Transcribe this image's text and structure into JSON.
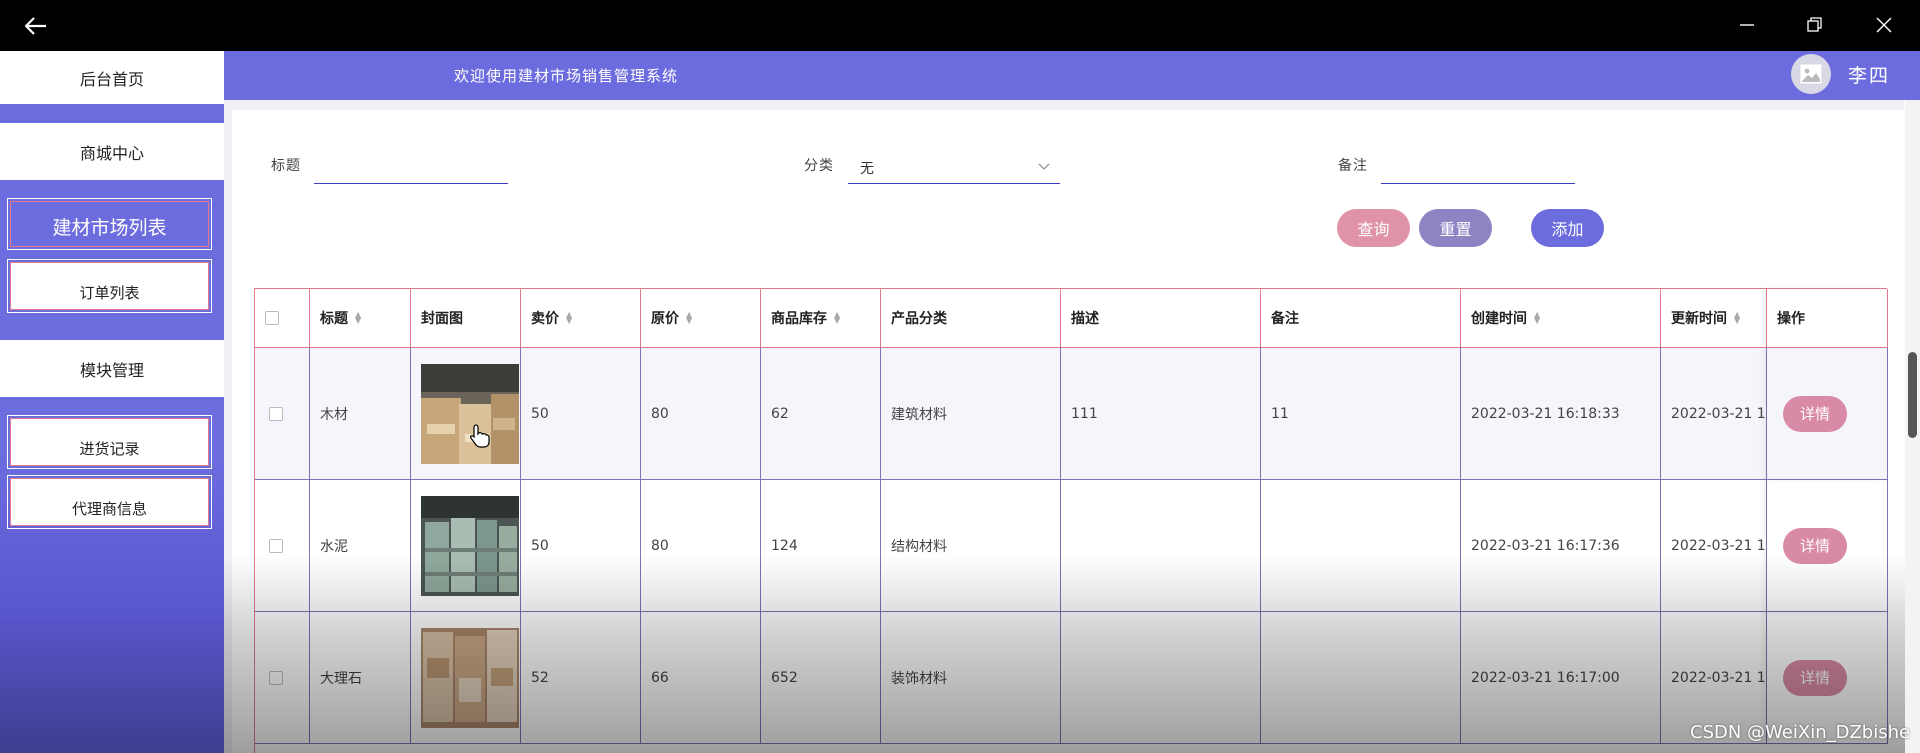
{
  "titlebar": {
    "back_icon": "arrow-left-icon",
    "minimize_icon": "minimize-icon",
    "restore_icon": "restore-icon",
    "close_icon": "close-icon"
  },
  "header": {
    "welcome": "欢迎使用建材市场销售管理系统",
    "username": "李四",
    "avatar_icon": "image-icon"
  },
  "sidebar": {
    "home": "后台首页",
    "mall_center": "商城中心",
    "market_list": "建材市场列表",
    "order_list": "订单列表",
    "module_mgmt": "模块管理",
    "purchase_records": "进货记录",
    "agent_info": "代理商信息"
  },
  "search": {
    "title_label": "标题",
    "title_value": "",
    "category_label": "分类",
    "category_value": "无",
    "remark_label": "备注",
    "remark_value": "",
    "query_btn": "查询",
    "reset_btn": "重置",
    "add_btn": "添加",
    "colors": {
      "query": "#df92a8",
      "reset": "#8e84c4",
      "add": "#6c6cdf"
    }
  },
  "table": {
    "headers": [
      "标题",
      "封面图",
      "卖价",
      "原价",
      "商品库存",
      "产品分类",
      "描述",
      "备注",
      "创建时间",
      "更新时间",
      "操作"
    ],
    "rows": [
      {
        "title": "木材",
        "price": "50",
        "orig": "80",
        "stock": "62",
        "category": "建筑材料",
        "desc": "111",
        "remark": "11",
        "created": "2022-03-21 16:18:33",
        "updated": "2022-03-21 1",
        "action": "详情",
        "image": "wood-warehouse"
      },
      {
        "title": "水泥",
        "price": "50",
        "orig": "80",
        "stock": "124",
        "category": "结构材料",
        "desc": "",
        "remark": "",
        "created": "2022-03-21 16:17:36",
        "updated": "2022-03-21 1",
        "action": "详情",
        "image": "cement-pallets"
      },
      {
        "title": "大理石",
        "price": "52",
        "orig": "66",
        "stock": "652",
        "category": "装饰材料",
        "desc": "",
        "remark": "",
        "created": "2022-03-21 16:17:00",
        "updated": "2022-03-21 1",
        "action": "详情",
        "image": "marble-slabs"
      }
    ]
  },
  "watermark": "CSDN @WeiXin_DZbishe"
}
